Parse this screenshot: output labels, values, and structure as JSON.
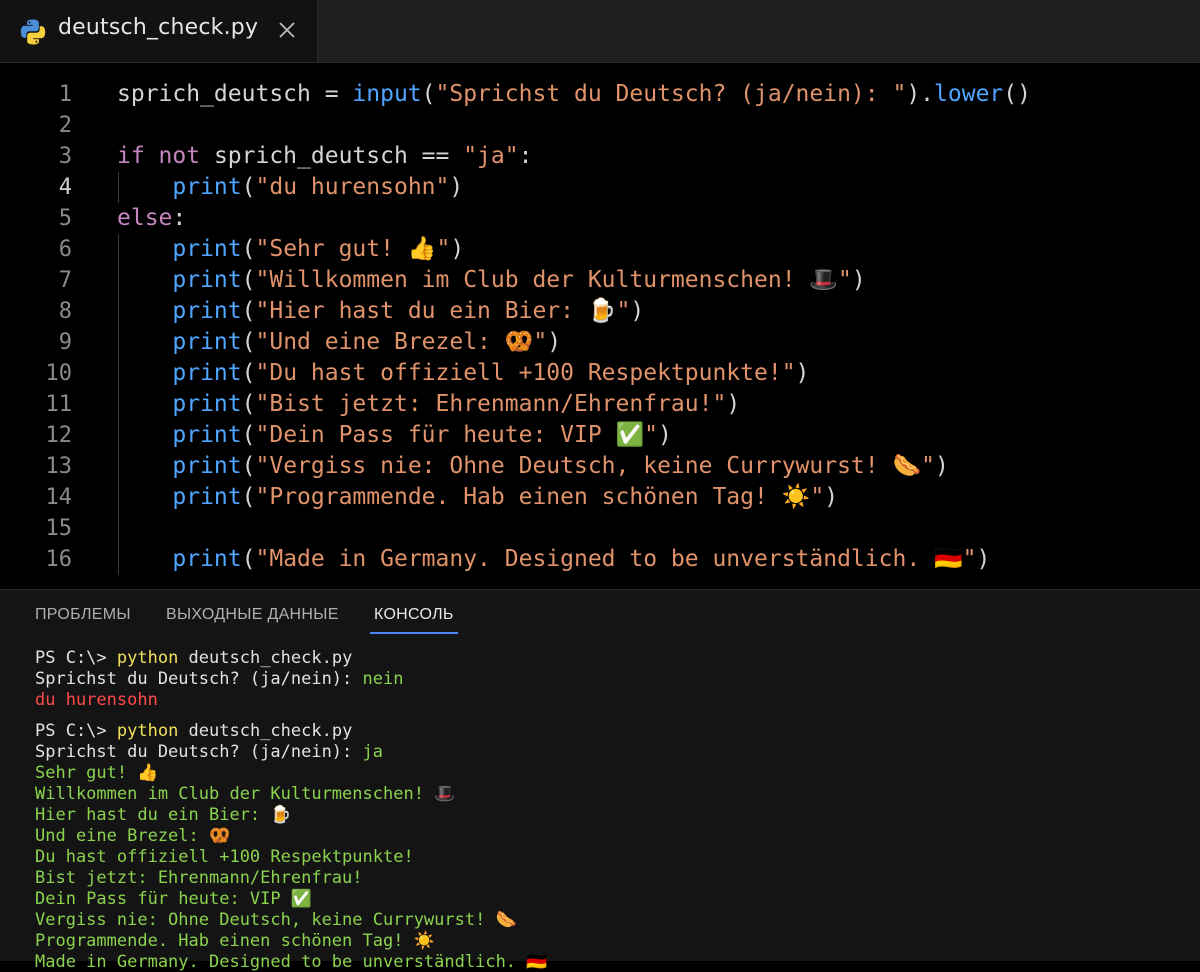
{
  "tab": {
    "filename": "deutsch_check.py",
    "icon": "python-icon",
    "close_icon": "close-icon"
  },
  "editor": {
    "active_line": 4,
    "lines": [
      {
        "n": "1",
        "tokens": [
          {
            "t": "sprich_deutsch = ",
            "c": "var"
          },
          {
            "t": "input",
            "c": "fn"
          },
          {
            "t": "(",
            "c": "var"
          },
          {
            "t": "\"Sprichst du Deutsch? (ja/nein): \"",
            "c": "str"
          },
          {
            "t": ").",
            "c": "var"
          },
          {
            "t": "lower",
            "c": "fn"
          },
          {
            "t": "()",
            "c": "var"
          }
        ]
      },
      {
        "n": "2",
        "tokens": []
      },
      {
        "n": "3",
        "tokens": [
          {
            "t": "if not",
            "c": "kw"
          },
          {
            "t": " sprich_deutsch == ",
            "c": "var"
          },
          {
            "t": "\"ja\"",
            "c": "str"
          },
          {
            "t": ":",
            "c": "var"
          }
        ]
      },
      {
        "n": "4",
        "tokens": [
          {
            "t": "    ",
            "c": "var"
          },
          {
            "t": "print",
            "c": "fn"
          },
          {
            "t": "(",
            "c": "var"
          },
          {
            "t": "\"du hurensohn\"",
            "c": "str"
          },
          {
            "t": ")",
            "c": "var"
          }
        ]
      },
      {
        "n": "5",
        "tokens": [
          {
            "t": "else",
            "c": "kw"
          },
          {
            "t": ":",
            "c": "var"
          }
        ]
      },
      {
        "n": "6",
        "tokens": [
          {
            "t": "    ",
            "c": "var"
          },
          {
            "t": "print",
            "c": "fn"
          },
          {
            "t": "(",
            "c": "var"
          },
          {
            "t": "\"Sehr gut! 👍\"",
            "c": "str"
          },
          {
            "t": ")",
            "c": "var"
          }
        ]
      },
      {
        "n": "7",
        "tokens": [
          {
            "t": "    ",
            "c": "var"
          },
          {
            "t": "print",
            "c": "fn"
          },
          {
            "t": "(",
            "c": "var"
          },
          {
            "t": "\"Willkommen im Club der Kulturmenschen! 🎩\"",
            "c": "str"
          },
          {
            "t": ")",
            "c": "var"
          }
        ]
      },
      {
        "n": "8",
        "tokens": [
          {
            "t": "    ",
            "c": "var"
          },
          {
            "t": "print",
            "c": "fn"
          },
          {
            "t": "(",
            "c": "var"
          },
          {
            "t": "\"Hier hast du ein Bier: 🍺\"",
            "c": "str"
          },
          {
            "t": ")",
            "c": "var"
          }
        ]
      },
      {
        "n": "9",
        "tokens": [
          {
            "t": "    ",
            "c": "var"
          },
          {
            "t": "print",
            "c": "fn"
          },
          {
            "t": "(",
            "c": "var"
          },
          {
            "t": "\"Und eine Brezel: 🥨\"",
            "c": "str"
          },
          {
            "t": ")",
            "c": "var"
          }
        ]
      },
      {
        "n": "10",
        "tokens": [
          {
            "t": "    ",
            "c": "var"
          },
          {
            "t": "print",
            "c": "fn"
          },
          {
            "t": "(",
            "c": "var"
          },
          {
            "t": "\"Du hast offiziell +100 Respektpunkte!\"",
            "c": "str"
          },
          {
            "t": ")",
            "c": "var"
          }
        ]
      },
      {
        "n": "11",
        "tokens": [
          {
            "t": "    ",
            "c": "var"
          },
          {
            "t": "print",
            "c": "fn"
          },
          {
            "t": "(",
            "c": "var"
          },
          {
            "t": "\"Bist jetzt: Ehrenmann/Ehrenfrau!\"",
            "c": "str"
          },
          {
            "t": ")",
            "c": "var"
          }
        ]
      },
      {
        "n": "12",
        "tokens": [
          {
            "t": "    ",
            "c": "var"
          },
          {
            "t": "print",
            "c": "fn"
          },
          {
            "t": "(",
            "c": "var"
          },
          {
            "t": "\"Dein Pass für heute: VIP ✅\"",
            "c": "str"
          },
          {
            "t": ")",
            "c": "var"
          }
        ]
      },
      {
        "n": "13",
        "tokens": [
          {
            "t": "    ",
            "c": "var"
          },
          {
            "t": "print",
            "c": "fn"
          },
          {
            "t": "(",
            "c": "var"
          },
          {
            "t": "\"Vergiss nie: Ohne Deutsch, keine Currywurst! 🌭\"",
            "c": "str"
          },
          {
            "t": ")",
            "c": "var"
          }
        ]
      },
      {
        "n": "14",
        "tokens": [
          {
            "t": "    ",
            "c": "var"
          },
          {
            "t": "print",
            "c": "fn"
          },
          {
            "t": "(",
            "c": "var"
          },
          {
            "t": "\"Programmende. Hab einen schönen Tag! ☀️\"",
            "c": "str"
          },
          {
            "t": ")",
            "c": "var"
          }
        ]
      },
      {
        "n": "15",
        "tokens": []
      },
      {
        "n": "16",
        "tokens": [
          {
            "t": "    ",
            "c": "var"
          },
          {
            "t": "print",
            "c": "fn"
          },
          {
            "t": "(",
            "c": "var"
          },
          {
            "t": "\"Made in Germany. Designed to be unverständlich. 🇩🇪\"",
            "c": "str"
          },
          {
            "t": ")",
            "c": "var"
          }
        ]
      }
    ]
  },
  "panel": {
    "tabs": [
      {
        "label": "ПРОБЛЕМЫ",
        "active": false
      },
      {
        "label": "ВЫХОДНЫЕ ДАННЫЕ",
        "active": false
      },
      {
        "label": "КОНСОЛЬ",
        "active": true
      }
    ],
    "terminal": [
      [
        {
          "t": "PS C:\\> ",
          "c": "plain"
        },
        {
          "t": "python",
          "c": "cmd"
        },
        {
          "t": " deutsch_check.py",
          "c": "plain"
        }
      ],
      [
        {
          "t": "Sprichst du Deutsch? (ja/nein): ",
          "c": "plain"
        },
        {
          "t": "nein",
          "c": "green"
        }
      ],
      [
        {
          "t": "du hurensohn",
          "c": "red"
        }
      ],
      [],
      [
        {
          "t": "PS C:\\> ",
          "c": "plain"
        },
        {
          "t": "python",
          "c": "cmd"
        },
        {
          "t": " deutsch_check.py",
          "c": "plain"
        }
      ],
      [
        {
          "t": "Sprichst du Deutsch? (ja/nein): ",
          "c": "plain"
        },
        {
          "t": "ja",
          "c": "green"
        }
      ],
      [
        {
          "t": "Sehr gut! 👍",
          "c": "green"
        }
      ],
      [
        {
          "t": "Willkommen im Club der Kulturmenschen! 🎩",
          "c": "green"
        }
      ],
      [
        {
          "t": "Hier hast du ein Bier: 🍺",
          "c": "green"
        }
      ],
      [
        {
          "t": "Und eine Brezel: 🥨",
          "c": "green"
        }
      ],
      [
        {
          "t": "Du hast offiziell +100 Respektpunkte!",
          "c": "green"
        }
      ],
      [
        {
          "t": "Bist jetzt: Ehrenmann/Ehrenfrau!",
          "c": "green"
        }
      ],
      [
        {
          "t": "Dein Pass für heute: VIP ✅",
          "c": "green"
        }
      ],
      [
        {
          "t": "Vergiss nie: Ohne Deutsch, keine Currywurst! 🌭",
          "c": "green"
        }
      ],
      [
        {
          "t": "Programmende. Hab einen schönen Tag! ☀️",
          "c": "green"
        }
      ],
      [
        {
          "t": "Made in Germany. Designed to be unverständlich. 🇩🇪",
          "c": "green"
        }
      ]
    ]
  },
  "colors": {
    "keyword": "#c586c0",
    "function": "#4fa6ff",
    "string": "#e0936a",
    "terminal_green": "#8bd34e",
    "terminal_red": "#ff4a4a",
    "terminal_cmd": "#f1e15a",
    "active_tab_underline": "#4a86ff"
  }
}
